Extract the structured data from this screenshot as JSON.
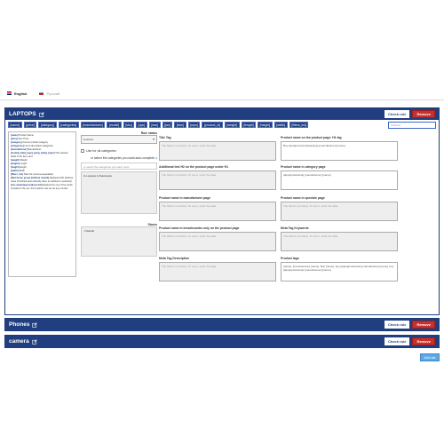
{
  "languages": [
    {
      "name": "English",
      "active": true
    },
    {
      "name": "Русский",
      "active": false
    }
  ],
  "rules": [
    {
      "title": "LAPTOPS",
      "check_label": "Check rule",
      "remove_label": "Remove",
      "variables": [
        "[name]",
        "[price]",
        "[category]",
        "[categories]",
        "[manufacturer]",
        "[model]",
        "[sku]",
        "[upc]",
        "[ean]",
        "[jan]",
        "[isbn]",
        "[mpn]",
        "[product_id]",
        "[weight]",
        "[length]",
        "[height]",
        "[width]",
        "[filters_list]"
      ],
      "attribute_placeholder": "Attribute",
      "var_help": [
        {
          "key": "[name]",
          "text": "Product Name"
        },
        {
          "key": "[price]",
          "text": "Item Price"
        },
        {
          "key": "[category]",
          "text": "Current product category"
        },
        {
          "key": "[categories]",
          "text": "List of all product categories"
        },
        {
          "key": "[manufacturer]",
          "text": "Manufacturer"
        },
        {
          "key": "[model], [sku], [upc], [ean], [isbn], [mpn]",
          "text": "The relevant fields in the item card"
        },
        {
          "key": "[weight]",
          "text": "Weight"
        },
        {
          "key": "[length]",
          "text": "Length"
        },
        {
          "key": "[height]",
          "text": "Height"
        },
        {
          "key": "[width]",
          "text": "Width"
        },
        {
          "key": "[filters_list]",
          "text": "Filter list (comma-separated)"
        },
        {
          "key": "[Red Green group attribute nested]",
          "text": "Replaced with attribute value (if defined automatically when an attribute is selected)"
        },
        {
          "key": "[one variant|second|one bit]",
          "text": "Replaced by one of the words included in the set. Such options can be set any number"
        }
      ],
      "rule_status_label": "Rule status",
      "rule_status_value": "Enabled",
      "all_categories_label": "Use for all categories",
      "select_categories_label": "or select the categories you want auto-complete",
      "category_search_placeholder": "or select the categories you want: apto",
      "selected_category": "Laptops & Notebooks",
      "stores_label": "Stores",
      "store_default": "Default",
      "fields": {
        "title_tag": {
          "label": "Title Tag",
          "value": "The field is not active. To use it, enter the data."
        },
        "h1": {
          "label": "Product name on the product page: H1 tag",
          "value": "Buy {best|premium|better|top} [manufacturer] [name]"
        },
        "additional_h2": {
          "label": "Additional text H2 on the product page under H1",
          "value": "The field is not active. To use it, enter the data."
        },
        "in_category": {
          "label": "Product name in category page",
          "value": "{laptop|notebook} [manufacturer] [name]"
        },
        "in_manufacturer": {
          "label": "Product name in manufacturer page",
          "value": "The field is not active. To use it, enter the data."
        },
        "in_specials": {
          "label": "Product name in specials page",
          "value": "The field is not active. To use it, enter the data."
        },
        "in_breadcrumbs": {
          "label": "Product name in breadcrumbs only on the product page",
          "value": "The field is not active. To use it, enter the data."
        },
        "meta_keywords": {
          "label": "Meta Tag Keywords",
          "value": "The field is not active. To use it, enter the data."
        },
        "meta_description": {
          "label": "Meta Tag Description",
          "value": "The field is not active. To use it, enter the data."
        },
        "product_tags": {
          "label": "Product tags",
          "value": "[name], [manufacturer] [name], Buy [name], buy {laptop|notebook} [manufacturer] [name], buy {laptop|notebook} [manufacturer] [name]"
        }
      }
    },
    {
      "title": "Phones",
      "check_label": "Check rule",
      "remove_label": "Remove"
    },
    {
      "title": "camera",
      "check_label": "Check rule",
      "remove_label": "Remove"
    }
  ],
  "add_rule_label": "Add rule",
  "colors": {
    "primary": "#203e80",
    "danger": "#c9302c",
    "info": "#5fa8e0"
  }
}
